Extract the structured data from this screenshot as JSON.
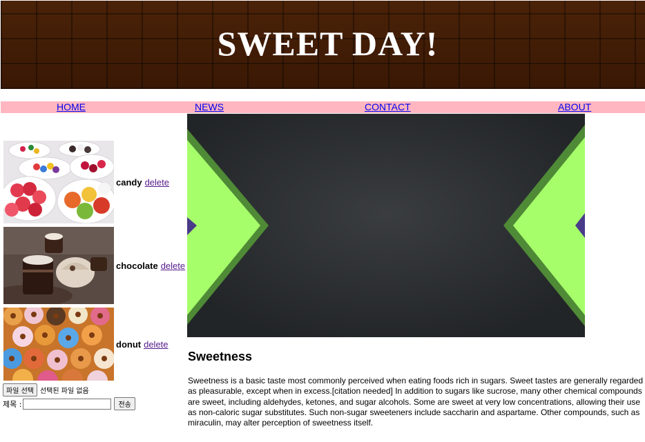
{
  "header": {
    "title": "SWEET DAY!"
  },
  "nav": {
    "home": "HOME",
    "news": "NEWS",
    "contact": "CONTACT",
    "about": "ABOUT"
  },
  "sidebar": {
    "items": [
      {
        "label": "candy",
        "action": "delete"
      },
      {
        "label": "chocolate",
        "action": "delete"
      },
      {
        "label": "donut",
        "action": "delete"
      }
    ]
  },
  "upload": {
    "choose_file_label": "파일 선택",
    "status": "선택된 파일 없음"
  },
  "title_form": {
    "label": "제목 :",
    "input_value": "",
    "submit_label": "전송"
  },
  "main": {
    "heading": "Sweetness",
    "paragraph": "Sweetness is a basic taste most commonly perceived when eating foods rich in sugars. Sweet tastes are generally regarded as pleasurable, except when in excess.[citation needed] In addition to sugars like sucrose, many other chemical compounds are sweet, including aldehydes, ketones, and sugar alcohols. Some are sweet at very low concentrations, allowing their use as non-caloric sugar substitutes. Such non-sugar sweeteners include saccharin and aspartame. Other compounds, such as miraculin, may alter perception of sweetness itself."
  },
  "colors": {
    "nav_bg": "#ffb6c1",
    "banner_bg": "#3d1a05",
    "link": "#0000ee",
    "visited_link": "#551a8b"
  }
}
